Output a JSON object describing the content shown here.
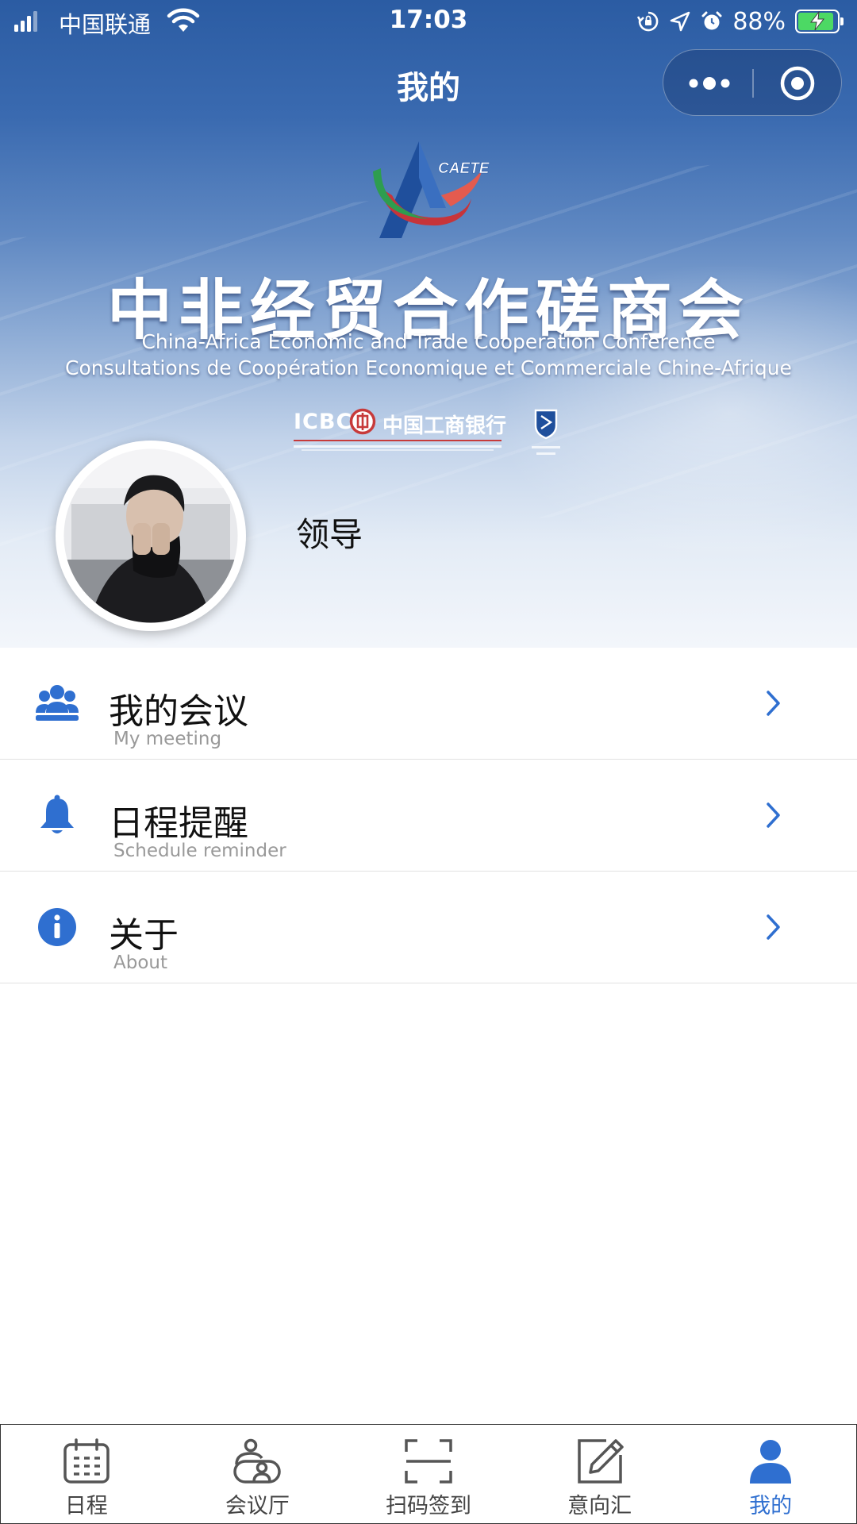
{
  "status_bar": {
    "carrier": "中国联通",
    "time": "17:03",
    "battery_percent": "88%",
    "battery_level": 0.88
  },
  "nav": {
    "title": "我的",
    "more_icon": "more-dots-icon",
    "close_icon": "target-icon"
  },
  "banner": {
    "logo_text": "CAETE",
    "title_cn": "中非经贸合作磋商会",
    "title_en": "China-Africa Economic and Trade Cooperation Conference",
    "title_fr": "Consultations de Coopération Economique et Commerciale Chine-Afrique",
    "sponsor_en": "ICBC",
    "sponsor_cn": "中国工商银行"
  },
  "profile": {
    "name": "领导"
  },
  "menu": {
    "items": [
      {
        "title": "我的会议",
        "subtitle": "My meeting",
        "icon": "group-icon"
      },
      {
        "title": "日程提醒",
        "subtitle": "Schedule reminder",
        "icon": "bell-icon"
      },
      {
        "title": "关于",
        "subtitle": "About",
        "icon": "info-icon"
      }
    ]
  },
  "tabbar": {
    "items": [
      {
        "label": "日程",
        "icon": "calendar-icon",
        "active": false
      },
      {
        "label": "会议厅",
        "icon": "meeting-hall-icon",
        "active": false
      },
      {
        "label": "扫码签到",
        "icon": "scan-icon",
        "active": false
      },
      {
        "label": "意向汇",
        "icon": "edit-icon",
        "active": false
      },
      {
        "label": "我的",
        "icon": "user-icon",
        "active": true
      }
    ]
  },
  "colors": {
    "accent": "#2f6fd0",
    "header_blue": "#2b5ca3",
    "battery_green": "#4cd964"
  }
}
